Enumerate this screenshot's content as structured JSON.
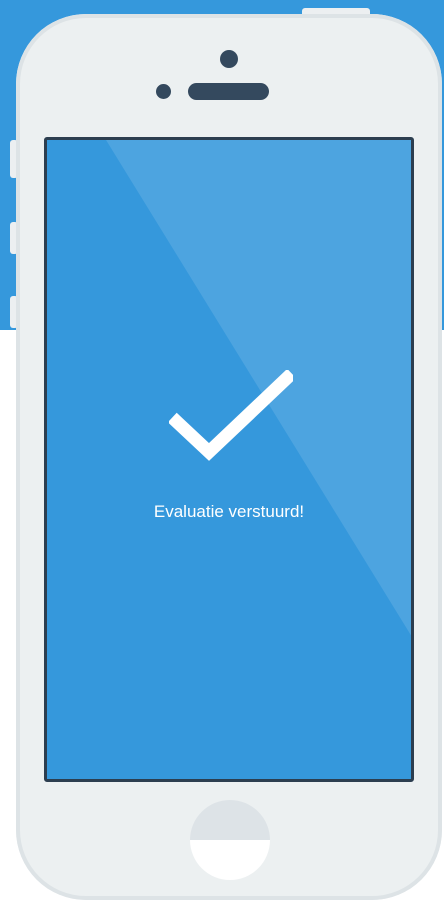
{
  "screen": {
    "message": "Evaluatie verstuurd!",
    "icon": "checkmark-icon"
  },
  "colors": {
    "brand_blue": "#3598dc",
    "phone_body": "#ecf0f1",
    "phone_dark": "#34495e",
    "screen_border": "#2c3e50"
  }
}
